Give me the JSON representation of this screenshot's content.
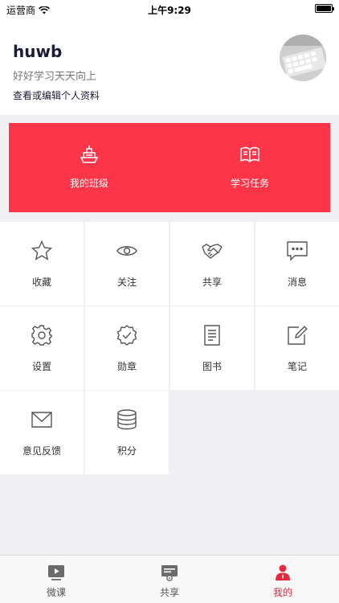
{
  "status_bar": {
    "carrier": "运营商",
    "time": "上午9:29"
  },
  "profile": {
    "username": "huwb",
    "motto": "好好学习天天向上",
    "edit_link": "查看或编辑个人资料"
  },
  "banner": {
    "items": [
      {
        "label": "我的班级",
        "icon": "ship-icon"
      },
      {
        "label": "学习任务",
        "icon": "open-book-icon"
      }
    ],
    "color": "#fd3548"
  },
  "grid": {
    "items": [
      {
        "label": "收藏",
        "icon": "star-icon"
      },
      {
        "label": "关注",
        "icon": "eye-icon"
      },
      {
        "label": "共享",
        "icon": "handshake-icon"
      },
      {
        "label": "消息",
        "icon": "message-icon"
      },
      {
        "label": "设置",
        "icon": "gear-icon"
      },
      {
        "label": "勋章",
        "icon": "badge-icon"
      },
      {
        "label": "图书",
        "icon": "document-icon"
      },
      {
        "label": "笔记",
        "icon": "note-edit-icon"
      },
      {
        "label": "意见反馈",
        "icon": "envelope-icon"
      },
      {
        "label": "积分",
        "icon": "coins-icon"
      }
    ]
  },
  "tabbar": {
    "items": [
      {
        "label": "微课",
        "icon": "video-icon"
      },
      {
        "label": "共享",
        "icon": "share-box-icon"
      },
      {
        "label": "我的",
        "icon": "person-icon",
        "active": true
      }
    ],
    "active_color": "#e8293d"
  }
}
